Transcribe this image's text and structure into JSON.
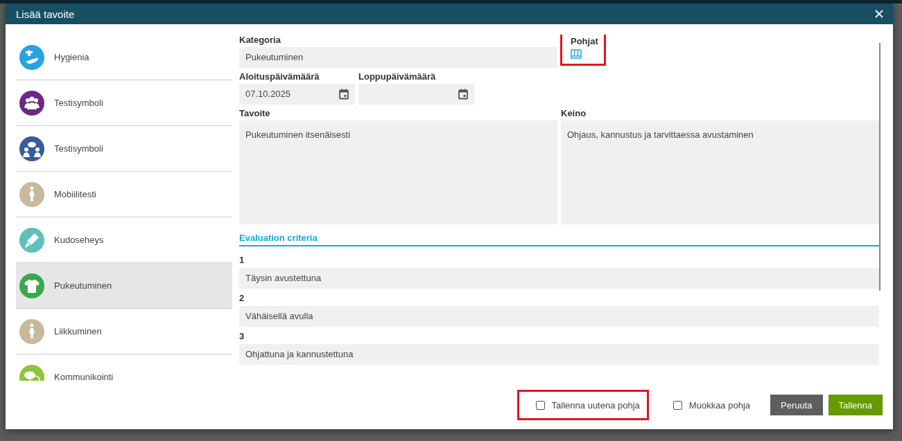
{
  "dialog": {
    "title": "Lisää tavoite"
  },
  "categories": [
    {
      "label": "Hygienia",
      "kind": "hygiene",
      "color": "#29a3df",
      "selected": false
    },
    {
      "label": "Testisymboli",
      "kind": "group",
      "color": "#6b2a86",
      "selected": false
    },
    {
      "label": "Testisymboli",
      "kind": "meeting",
      "color": "#3a5a9a",
      "selected": false
    },
    {
      "label": "Mobiilitesti",
      "kind": "walker",
      "color": "#c8b89c",
      "selected": false
    },
    {
      "label": "Kudoseheys",
      "kind": "bandage",
      "color": "#5fc0b8",
      "selected": false
    },
    {
      "label": "Pukeutuminen",
      "kind": "shirt",
      "color": "#3aa84a",
      "selected": true
    },
    {
      "label": "Liikkuminen",
      "kind": "walker",
      "color": "#c8b89c",
      "selected": false
    },
    {
      "label": "Kommunikointi",
      "kind": "chat",
      "color": "#8cc43c",
      "selected": false
    }
  ],
  "form": {
    "category": {
      "label": "Kategoria",
      "value": "Pukeutuminen"
    },
    "templates": {
      "label": "Pohjat",
      "highlighted": true
    },
    "start_date": {
      "label": "Aloituspäivämäärä",
      "value": "07.10.2025"
    },
    "end_date": {
      "label": "Loppupäivämäärä"
    },
    "goal": {
      "label": "Tavoite",
      "value": "Pukeutuminen itsenäisesti"
    },
    "means": {
      "label": "Keino",
      "value": "Ohjaus, kannustus ja tarvittaessa avustaminen"
    },
    "evaluation": {
      "title": "Evaluation criteria",
      "criteria": [
        {
          "number": "1",
          "value": "Täysin avustettuna"
        },
        {
          "number": "2",
          "value": "Vähäisellä avulla"
        },
        {
          "number": "3",
          "value": "Ohjattuna ja kannustettuna"
        }
      ]
    }
  },
  "footer": {
    "options": [
      {
        "label": "Tallenna uutena pohja",
        "checked": false,
        "highlighted": true
      },
      {
        "label": "Muokkaa pohja",
        "checked": false,
        "highlighted": false
      }
    ],
    "buttons": [
      {
        "label": "Peruuta",
        "kind": "secondary"
      },
      {
        "label": "Tallenna",
        "kind": "primary"
      }
    ]
  }
}
